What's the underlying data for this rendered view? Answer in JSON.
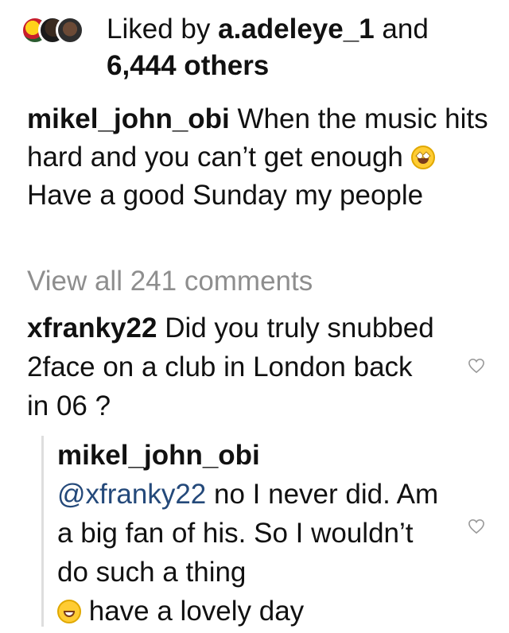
{
  "likes": {
    "prefix": "Liked by",
    "user": "a.adeleye_1",
    "and": "and",
    "count": "6,444 others"
  },
  "post": {
    "author": "mikel_john_obi",
    "caption_part1": "When the music hits hard and you can’t get enough",
    "emoji1": "star-struck-emoji",
    "caption_part2": "Have a good Sunday my people"
  },
  "view_all": "View all 241 comments",
  "comment": {
    "author": "xfranky22",
    "text": "Did you truly snubbed 2face on a club in London back in 06 ?"
  },
  "reply": {
    "author": "mikel_john_obi",
    "mention": "@xfranky22",
    "text": "no I never did. Am a big fan of his. So I wouldn’t do such a thing",
    "emoji": "grinning-emoji",
    "text2": "have a lovely day"
  },
  "colors": {
    "text": "#111111",
    "muted": "#8e8e8e",
    "mention": "#24497a"
  }
}
